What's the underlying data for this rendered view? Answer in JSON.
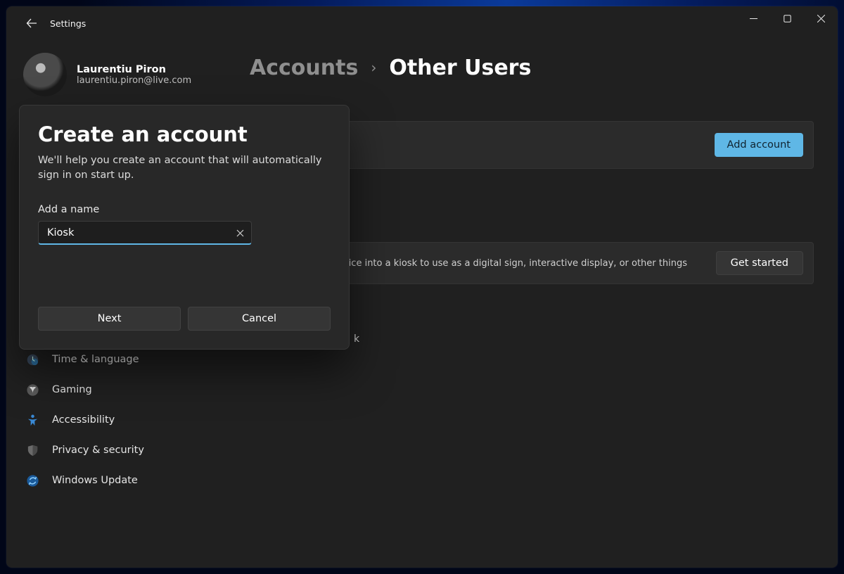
{
  "window": {
    "app_title": "Settings"
  },
  "profile": {
    "name": "Laurentiu Piron",
    "email": "laurentiu.piron@live.com"
  },
  "sidebar": {
    "items": [
      {
        "label": "Time & language",
        "icon": "clock-globe-icon"
      },
      {
        "label": "Gaming",
        "icon": "xbox-icon"
      },
      {
        "label": "Accessibility",
        "icon": "accessibility-icon"
      },
      {
        "label": "Privacy & security",
        "icon": "shield-icon"
      },
      {
        "label": "Windows Update",
        "icon": "sync-icon"
      }
    ]
  },
  "breadcrumb": {
    "parent": "Accounts",
    "current": "Other Users"
  },
  "other_users_card": {
    "add_account_label": "Add account"
  },
  "kiosk_card": {
    "description_fragment": "evice into a kiosk to use as a digital sign, interactive display, or other things",
    "get_started_label": "Get started"
  },
  "hidden_main_text_fragment": "k",
  "dialog": {
    "title": "Create an account",
    "description": "We'll help you create an account that will automatically sign in on start up.",
    "field_label": "Add a name",
    "field_value": "Kiosk",
    "next_label": "Next",
    "cancel_label": "Cancel"
  },
  "colors": {
    "accent": "#5fb7e6",
    "window_bg": "#202020",
    "card_bg": "#2b2b2b",
    "dialog_bg": "#282828"
  }
}
